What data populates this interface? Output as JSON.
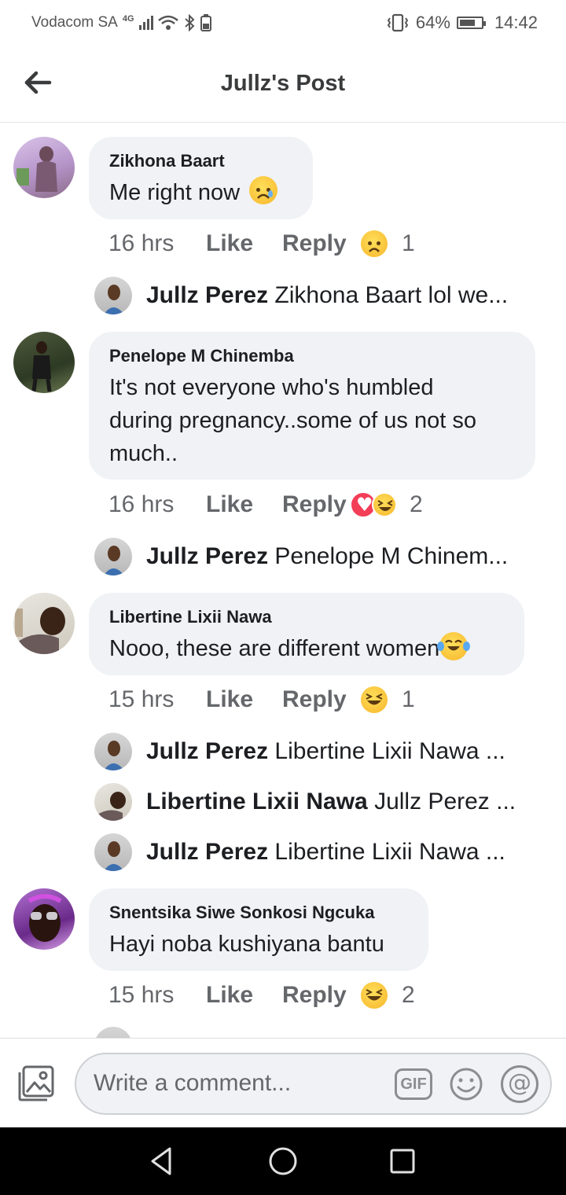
{
  "status_bar": {
    "carrier": "Vodacom SA",
    "network": "4G",
    "battery_percent": "64%",
    "time": "14:42"
  },
  "header": {
    "title": "Jullz's Post"
  },
  "comments": [
    {
      "author": "Zikhona Baart",
      "text": "Me right now",
      "emoji": "sad-face",
      "time": "16 hrs",
      "like": "Like",
      "reply": "Reply",
      "reactions": [
        "sad"
      ],
      "reaction_count": "1",
      "replies": [
        {
          "author": "Jullz Perez",
          "text": "Zikhona Baart lol we..."
        }
      ]
    },
    {
      "author": "Penelope M Chinemba",
      "text_lines": [
        "It's not everyone who's humbled",
        "during pregnancy..some of us not so",
        "much.."
      ],
      "time": "16 hrs",
      "like": "Like",
      "reply": "Reply",
      "reactions": [
        "love",
        "haha"
      ],
      "reaction_count": "2",
      "replies": [
        {
          "author": "Jullz Perez",
          "text": "Penelope M Chinem..."
        }
      ]
    },
    {
      "author": "Libertine Lixii Nawa",
      "text": "Nooo, these are different women",
      "emoji": "laughing-tears",
      "time": "15 hrs",
      "like": "Like",
      "reply": "Reply",
      "reactions": [
        "haha"
      ],
      "reaction_count": "1",
      "replies": [
        {
          "author": "Jullz Perez",
          "text": "Libertine Lixii Nawa ..."
        },
        {
          "author": "Libertine Lixii Nawa",
          "text": "Jullz Perez ..."
        },
        {
          "author": "Jullz Perez",
          "text": "Libertine Lixii Nawa ..."
        }
      ]
    },
    {
      "author": "Snentsika Siwe Sonkosi Ngcuka",
      "text": "Hayi noba kushiyana bantu",
      "time": "15 hrs",
      "like": "Like",
      "reply": "Reply",
      "reactions": [
        "haha"
      ],
      "reaction_count": "2"
    }
  ],
  "composer": {
    "placeholder": "Write a comment...",
    "gif_label": "GIF",
    "at_label": "@"
  },
  "colors": {
    "bubble": "#f0f2f5",
    "meta_text": "#65676b",
    "love": "#f33e58",
    "haha": "#f7b52b"
  }
}
